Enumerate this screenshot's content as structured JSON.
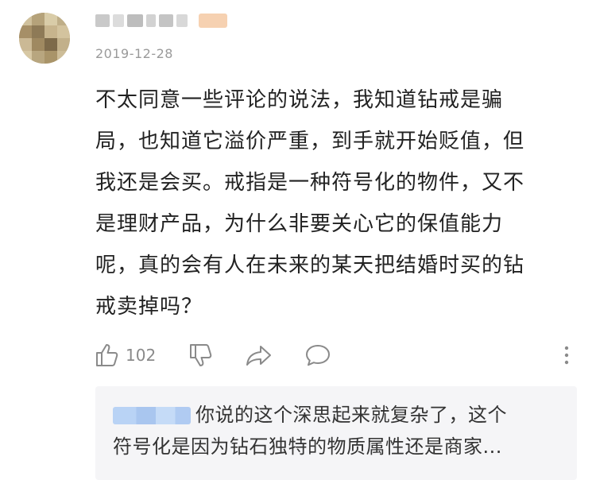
{
  "comment": {
    "date": "2019-12-28",
    "lines": [
      "不太同意一些评论的说法，我知道钻戒是骗",
      "局，也知道它溢价严重，到手就开始贬值，但",
      "我还是会买。戒指是一种符号化的物件，又不",
      "是理财产品，为什么非要关心它的保值能力",
      "呢，真的会有人在未来的某天把结婚时买的钻",
      "戒卖掉吗？"
    ]
  },
  "actions": {
    "like_count": "102",
    "icons": [
      "thumbs-up-icon",
      "thumbs-down-icon",
      "share-icon",
      "comment-icon",
      "more-icon"
    ]
  },
  "reply": {
    "lines": [
      "你说的这个深思起来就复杂了，这个",
      "符号化是因为钻石独特的物质属性还是商家..."
    ]
  },
  "colors": {
    "text": "#222222",
    "muted": "#9a9a9a",
    "reply_bg": "#f5f5f7"
  }
}
